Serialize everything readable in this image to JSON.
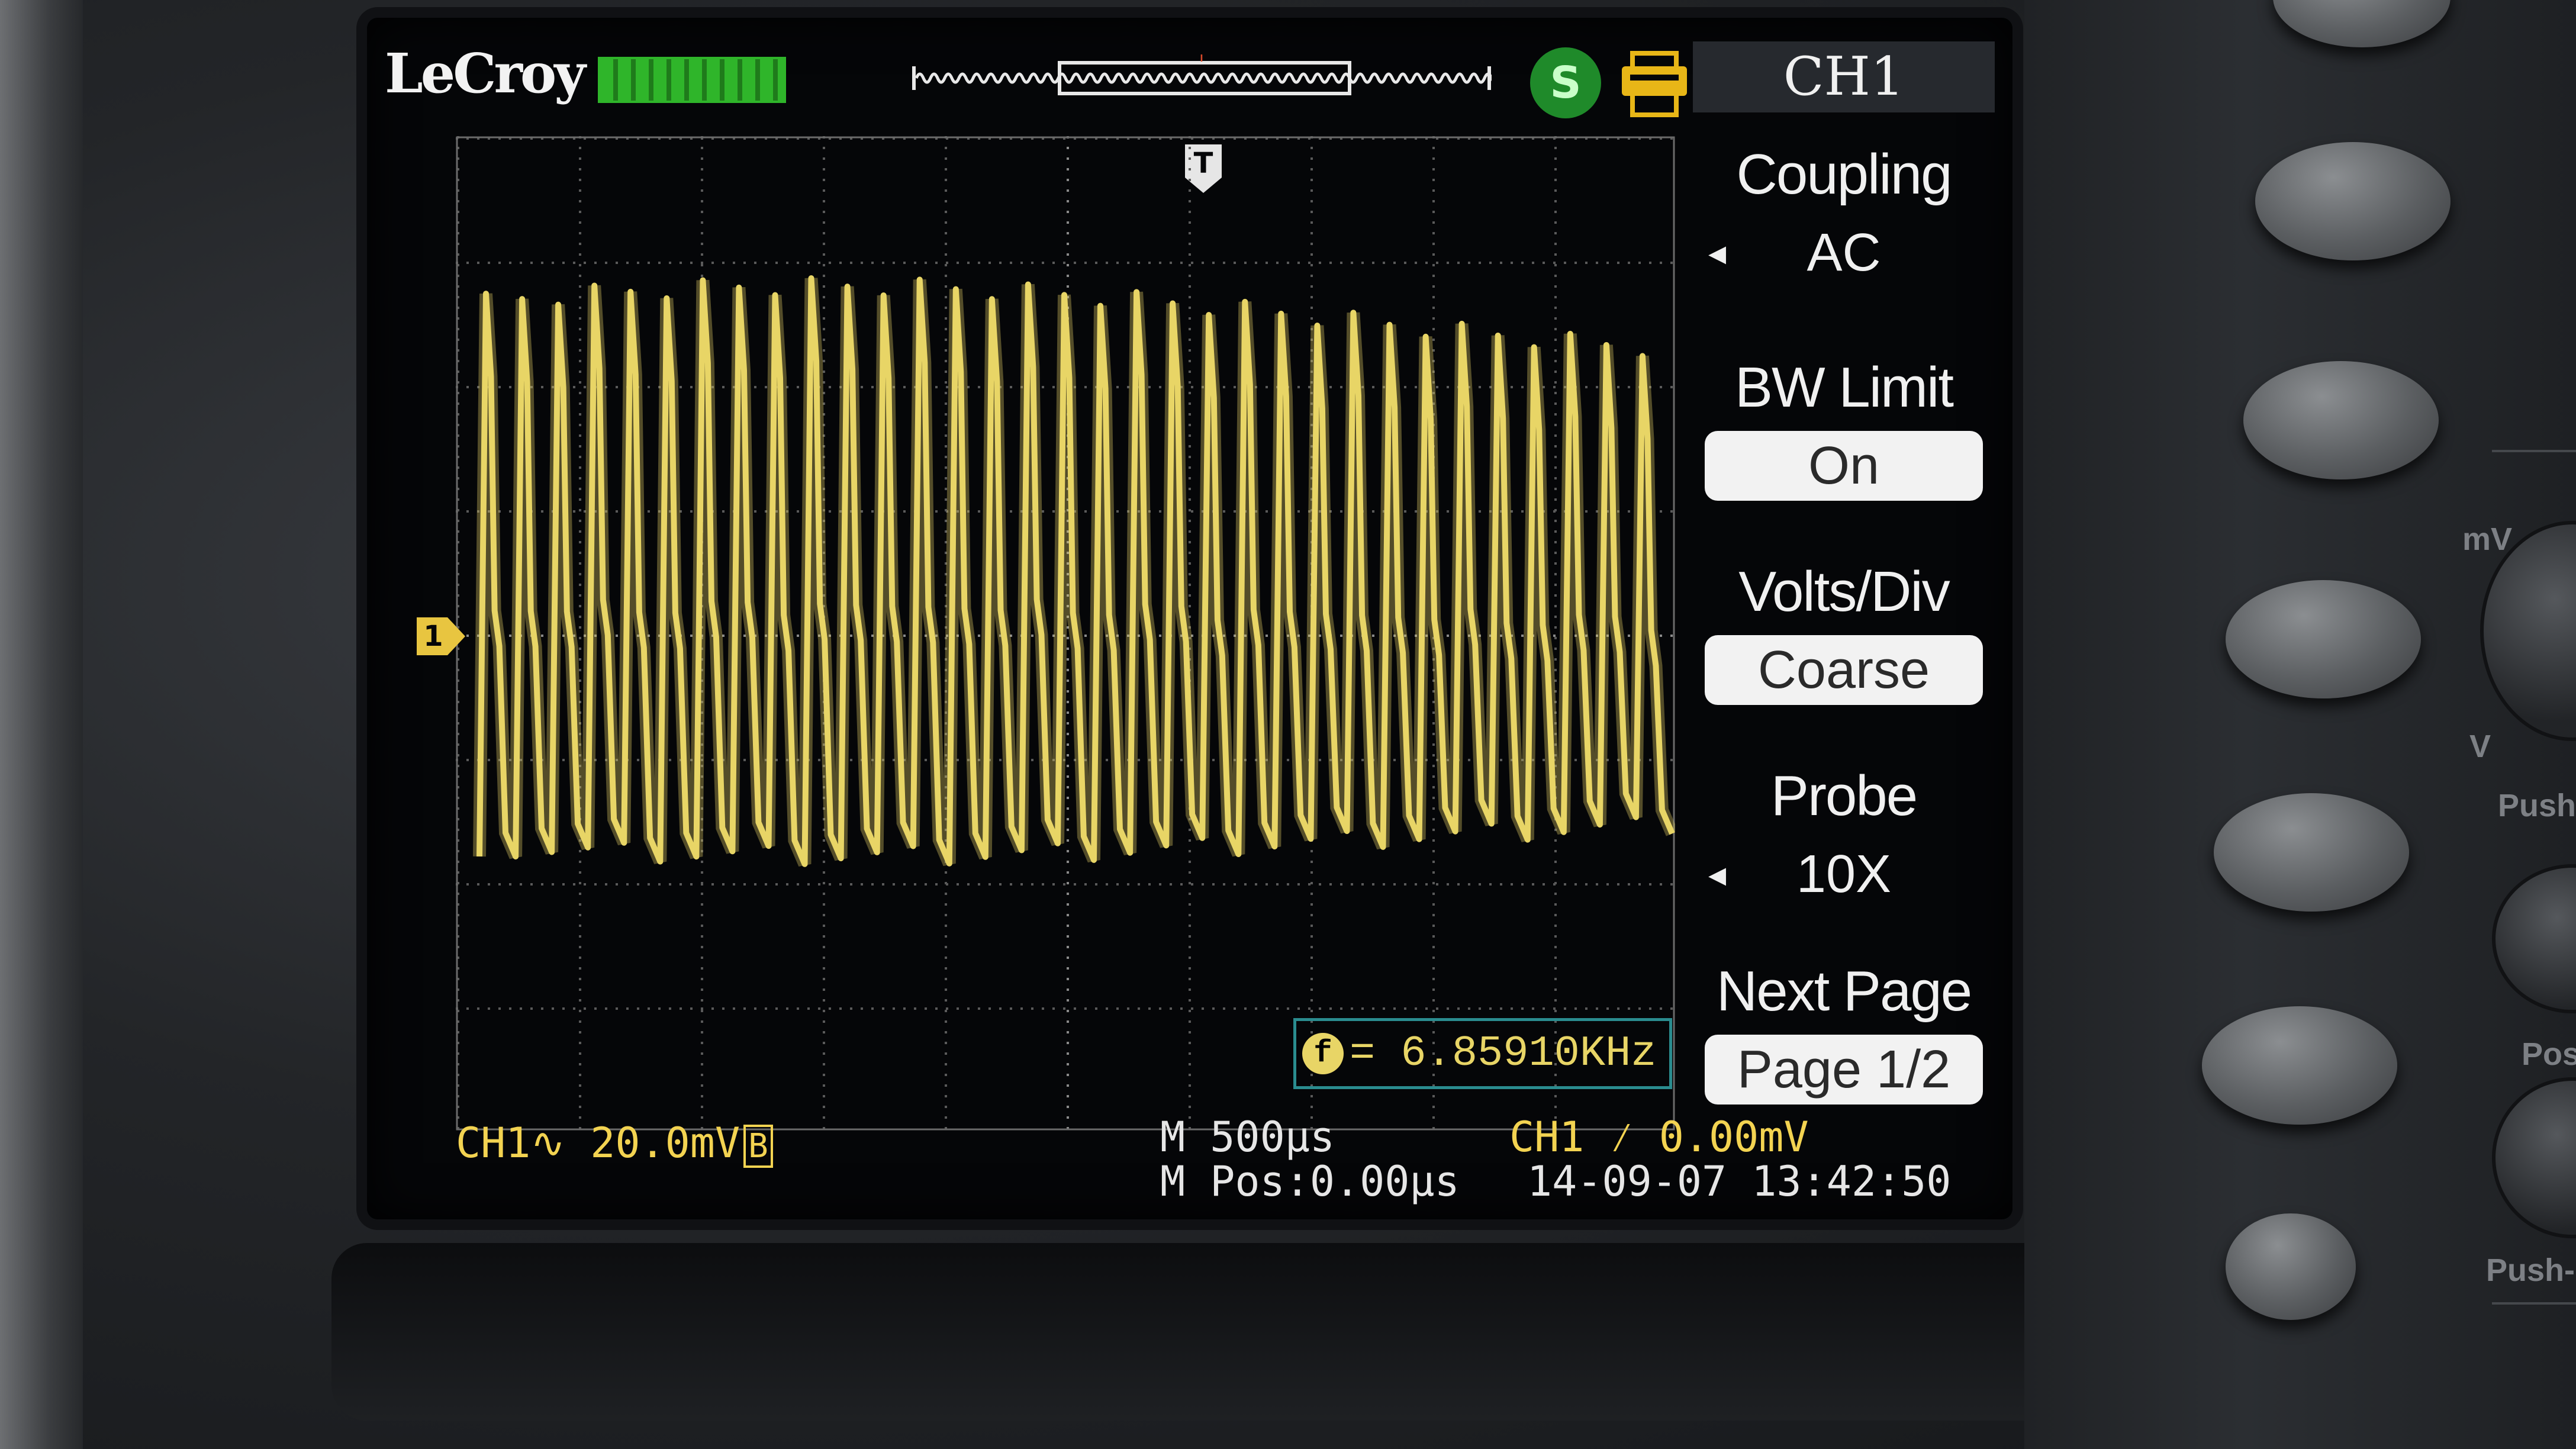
{
  "screen": {
    "brand": "LeCroy",
    "icons": {
      "battery": "battery-level-icon",
      "run_state": "run-state-icon",
      "printer": "printer-icon",
      "trigger": "trigger-position-marker",
      "channel_ground": "ch1-ground-marker"
    },
    "run_badge": "S",
    "trigger_marker": "T",
    "ch1_marker": "1",
    "colors": {
      "trace": "#e8d566",
      "accent": "#2fb52a",
      "status_text": "#f3d351"
    }
  },
  "menu": {
    "title": "CH1",
    "sections": [
      {
        "label": "Coupling",
        "value": "AC",
        "style": "plain"
      },
      {
        "label": "BW Limit",
        "value": "On",
        "style": "pill"
      },
      {
        "label": "Volts/Div",
        "value": "Coarse",
        "style": "pill"
      },
      {
        "label": "Probe",
        "value": "10X",
        "style": "plain"
      },
      {
        "label": "Next Page",
        "value": "Page 1/2",
        "style": "pill"
      }
    ]
  },
  "measurement": {
    "badge": "f",
    "text": "= 6.85910KHz"
  },
  "status_bar": {
    "channel": "CH1∿ 20.0mV",
    "channel_badge": "B",
    "timebase": "M 500μs",
    "position": "M Pos:0.00μs",
    "trigger": "CH1 ⁄ 0.00mV",
    "datetime": "14-09-07 13:42:50"
  },
  "panel": {
    "labels": {
      "mv": "mV",
      "v": "V",
      "push1": "Push",
      "pos": "Pos",
      "push2": "Push-"
    }
  },
  "waveform": {
    "cycles": 33,
    "description_free": true
  }
}
